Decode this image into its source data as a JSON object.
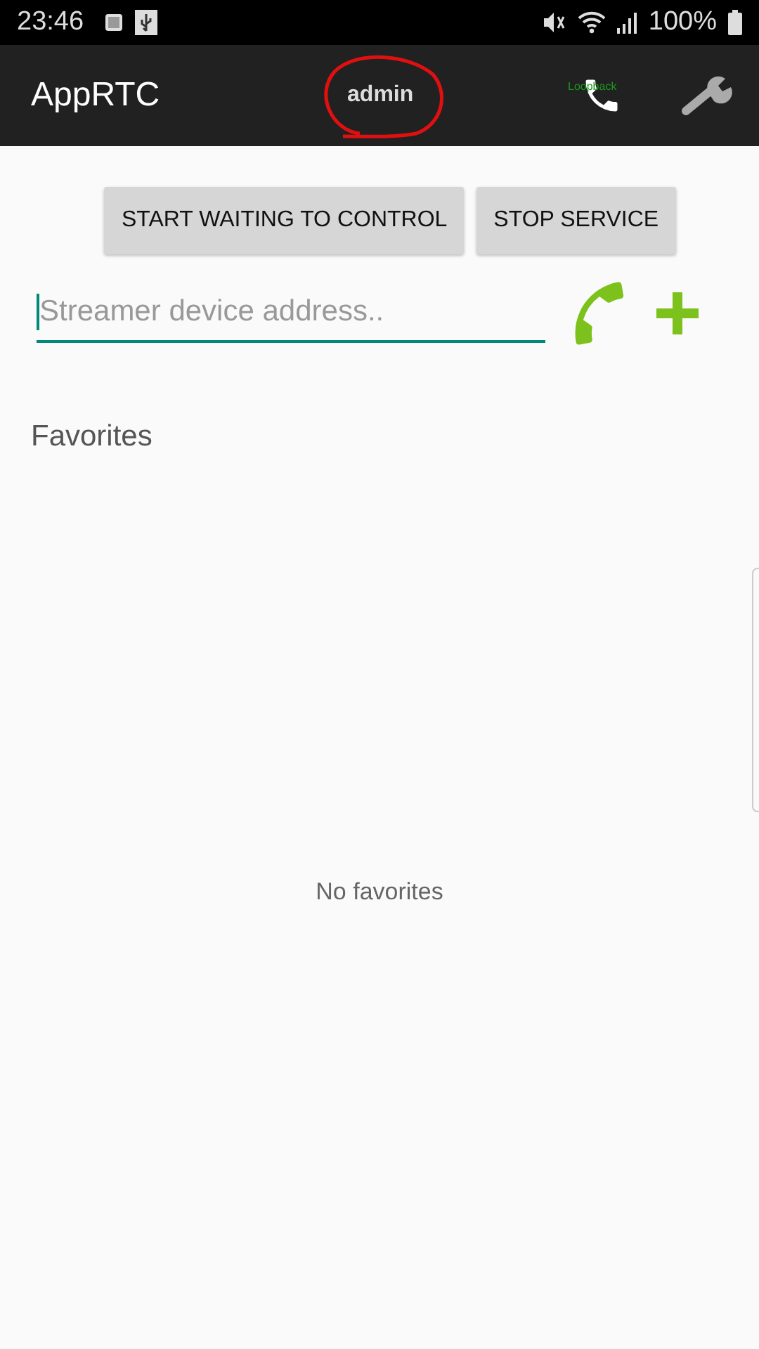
{
  "status_bar": {
    "time": "23:46",
    "battery": "100%"
  },
  "app_bar": {
    "title": "AppRTC",
    "user": "admin",
    "call_label": "Loopback"
  },
  "buttons": [
    {
      "label": "START WAITING TO CONTROL"
    },
    {
      "label": "STOP SERVICE"
    }
  ],
  "address_field": {
    "placeholder": "Streamer device address.."
  },
  "favorites": {
    "title": "Favorites",
    "empty_text": "No favorites"
  }
}
